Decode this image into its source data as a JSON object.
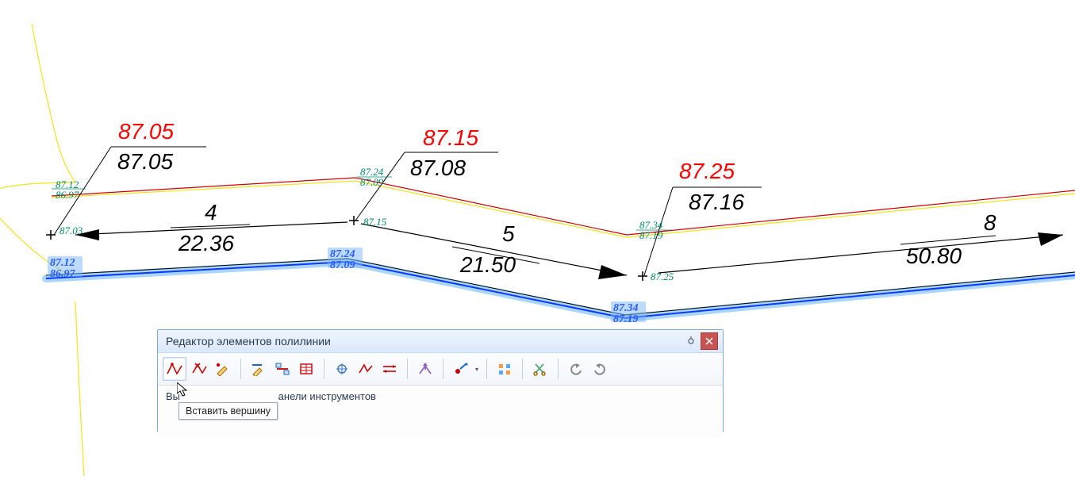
{
  "canvas": {
    "labels": {
      "p1_red": "87.05",
      "p1_black": "87.05",
      "p2_red": "87.15",
      "p2_black": "87.08",
      "p3_red": "87.25",
      "p3_black": "87.16",
      "top_left_teal_a": "87.12",
      "top_left_teal_b": "86.97",
      "mid_teal_a": "87.24",
      "mid_teal_b": "87.09",
      "right_teal_a": "87.34",
      "right_teal_b": "87.19",
      "v1_teal": "87.03",
      "v2_teal": "87.15",
      "v3_teal": "87.25",
      "sel_left_a": "87.12",
      "sel_left_b": "86.97",
      "sel_mid_a": "87.24",
      "sel_mid_b": "87.09",
      "sel_right_a": "87.34",
      "sel_right_b": "87.19",
      "arrow1_num": "4",
      "arrow1_val": "22.36",
      "arrow2_num": "5",
      "arrow2_val": "21.50",
      "arrow3_num": "8",
      "arrow3_val": "50.80"
    }
  },
  "window": {
    "title": "Редактор элементов полилинии",
    "status_prefix": "Вы",
    "status_suffix": "анели инструментов",
    "tooltip": "Вставить вершину"
  }
}
